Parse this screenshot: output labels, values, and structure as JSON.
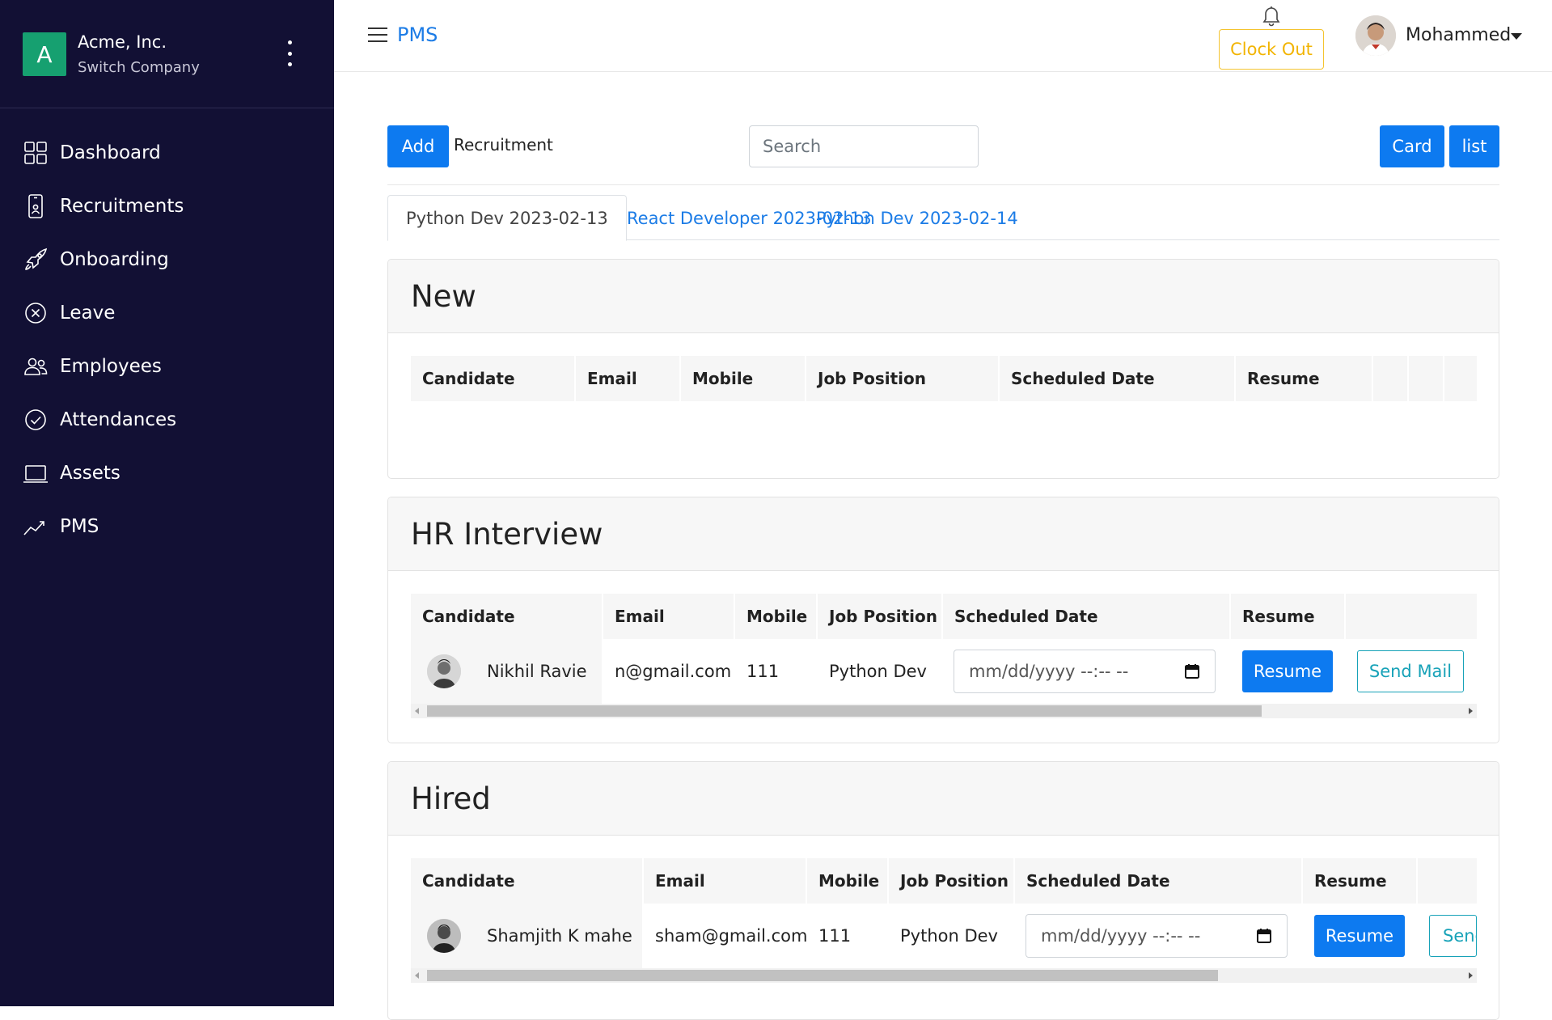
{
  "company": {
    "logo_letter": "A",
    "name": "Acme, Inc.",
    "switch_label": "Switch Company"
  },
  "sidebar": {
    "items": [
      {
        "label": "Dashboard",
        "icon": "grid-icon"
      },
      {
        "label": "Recruitments",
        "icon": "phone-person-icon"
      },
      {
        "label": "Onboarding",
        "icon": "rocket-icon"
      },
      {
        "label": "Leave",
        "icon": "x-circle-icon"
      },
      {
        "label": "Employees",
        "icon": "people-icon"
      },
      {
        "label": "Attendances",
        "icon": "check-circle-icon"
      },
      {
        "label": "Assets",
        "icon": "laptop-icon"
      },
      {
        "label": "PMS",
        "icon": "graph-up-icon"
      }
    ]
  },
  "topbar": {
    "brand": "PMS",
    "clock_out": "Clock Out",
    "user_name": "Mohammed"
  },
  "toolbar": {
    "add_label": "Add",
    "section_label": "Recruitment",
    "search_placeholder": "Search",
    "card_label": "Card",
    "list_label": "list"
  },
  "tabs": [
    {
      "label": "Python Dev 2023-02-13",
      "active": true
    },
    {
      "label": "React Developer 2023-02-13",
      "active": false
    },
    {
      "label": "Python Dev 2023-02-14",
      "active": false
    }
  ],
  "columns": [
    "Candidate",
    "Email",
    "Mobile",
    "Job Position",
    "Scheduled Date",
    "Resume"
  ],
  "stages": [
    {
      "title": "New",
      "rows": []
    },
    {
      "title": "HR Interview",
      "rows": [
        {
          "candidate": "Nikhil Ravie",
          "email": "n@gmail.com",
          "mobile": "111",
          "job_position": "Python Dev",
          "date_placeholder": "mm/dd/yyyy --:-- --",
          "resume_label": "Resume",
          "mail_label": "Send Mail"
        }
      ]
    },
    {
      "title": "Hired",
      "rows": [
        {
          "candidate": "Shamjith K mahe",
          "email": "sham@gmail.com",
          "mobile": "111",
          "job_position": "Python Dev",
          "date_placeholder": "mm/dd/yyyy --:-- --",
          "resume_label": "Resume",
          "mail_label": "Send"
        }
      ]
    }
  ],
  "colors": {
    "sidebar_bg": "#121034",
    "primary": "#0d7af0",
    "warning": "#f2b400",
    "info": "#17a2b8",
    "logo_bg": "#16a070"
  }
}
